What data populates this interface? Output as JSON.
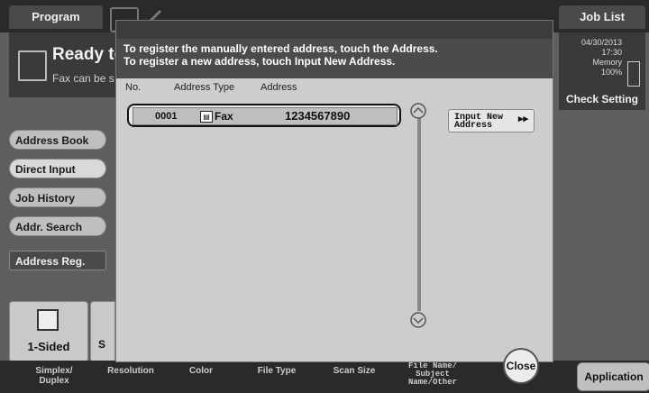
{
  "background": {
    "tab_program": "Program",
    "tab_joblist": "Job List",
    "ready_title": "Ready to",
    "ready_sub": "Fax can be s",
    "status": {
      "date": "04/30/2013",
      "time": "17:30",
      "memory_label": "Memory",
      "memory_value": "100%"
    },
    "check_setting": "Check Setting",
    "side_buttons": [
      "Address Book",
      "Direct Input",
      "Job History",
      "Addr. Search",
      "Address Reg."
    ],
    "tile_label": "1-Sided",
    "tile2_label": "S",
    "bottom_labels": {
      "simplex": "Simplex/\nDuplex",
      "resolution": "Resolution",
      "color": "Color",
      "file_type": "File Type",
      "scan_size": "Scan Size",
      "file_name": "File Name/\nSubject\nName/Other"
    },
    "application": "Application"
  },
  "dialog": {
    "message_line1": "To register the manually entered address, touch the Address.",
    "message_line2": "To register a new address, touch Input New Address.",
    "columns": {
      "no": "No.",
      "type": "Address Type",
      "address": "Address"
    },
    "rows": [
      {
        "no": "0001",
        "type": "Fax",
        "address": "1234567890"
      }
    ],
    "input_new_line1": "Input New",
    "input_new_line2": "Address",
    "close": "Close"
  }
}
